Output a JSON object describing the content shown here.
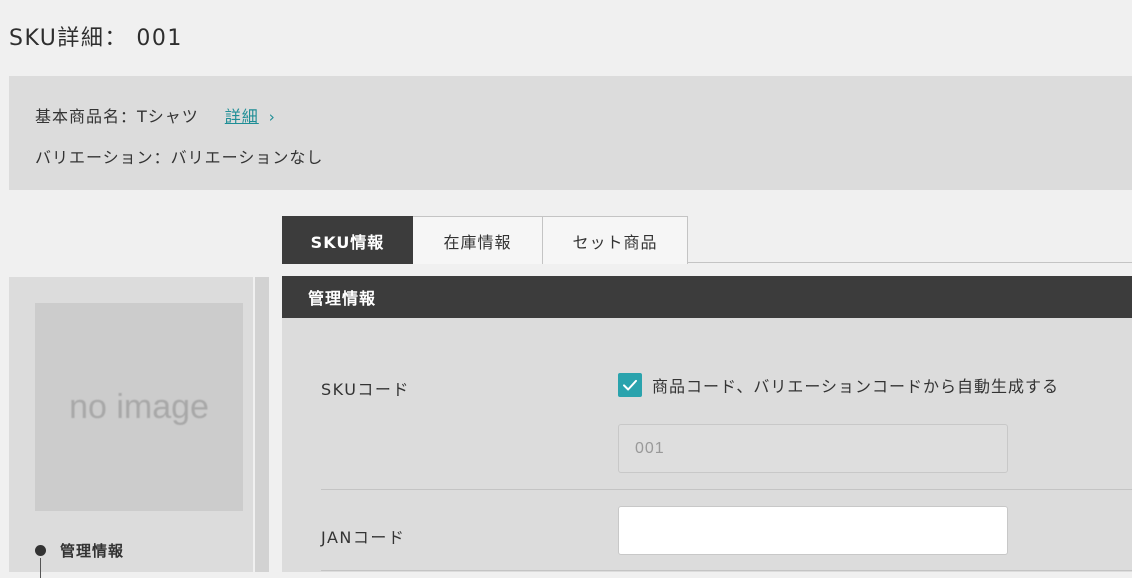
{
  "page": {
    "title": "SKU詳細： 001"
  },
  "info": {
    "product_name_label": "基本商品名：Tシャツ",
    "detail_link": "詳細",
    "variation_label": "バリエーション：バリエーションなし"
  },
  "tabs": [
    {
      "label": "SKU情報",
      "active": true
    },
    {
      "label": "在庫情報",
      "active": false
    },
    {
      "label": "セット商品",
      "active": false
    }
  ],
  "sidebar": {
    "image_placeholder": "no image",
    "nav_items": [
      {
        "label": "管理情報"
      }
    ]
  },
  "panel": {
    "title": "管理情報",
    "sku_code": {
      "label": "SKUコード",
      "auto_generate_checked": true,
      "auto_generate_label": "商品コード、バリエーションコードから自動生成する",
      "value": "001"
    },
    "jan_code": {
      "label": "JANコード",
      "value": ""
    }
  },
  "colors": {
    "accent": "#2aa3ad",
    "link": "#1f8e96",
    "dark_header": "#3c3c3c",
    "panel_bg": "#dcdcdc"
  },
  "icons": {
    "chevron": "chevron-right-icon",
    "check": "check-icon"
  }
}
